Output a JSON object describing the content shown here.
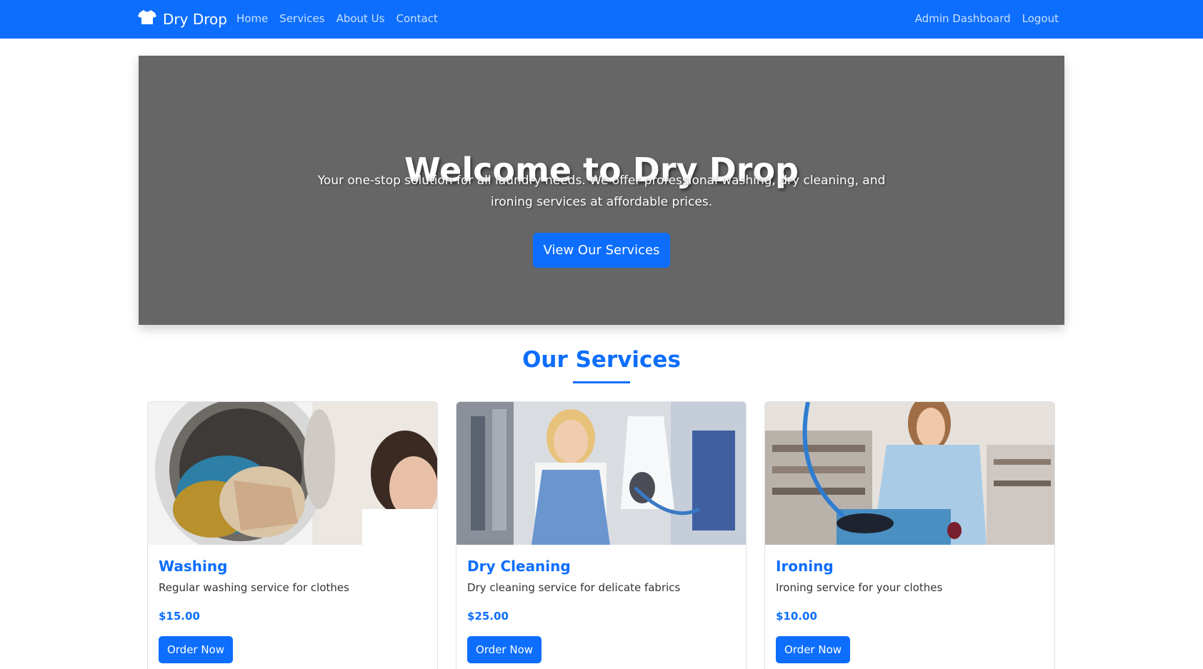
{
  "nav": {
    "brand": "Dry Drop",
    "brand_icon": "tshirt-icon",
    "links": [
      "Home",
      "Services",
      "About Us",
      "Contact"
    ],
    "right_links": [
      "Admin Dashboard",
      "Logout"
    ]
  },
  "hero": {
    "title": "Welcome to Dry Drop",
    "text": "Your one-stop solution for all laundry needs. We offer professional washing, dry cleaning, and ironing services at affordable prices.",
    "button": "View Our Services"
  },
  "services": {
    "heading": "Our Services",
    "cards": [
      {
        "title": "Washing",
        "description": "Regular washing service for clothes",
        "price": "$15.00",
        "button": "Order Now"
      },
      {
        "title": "Dry Cleaning",
        "description": "Dry cleaning service for delicate fabrics",
        "price": "$25.00",
        "button": "Order Now"
      },
      {
        "title": "Ironing",
        "description": "Ironing service for your clothes",
        "price": "$10.00",
        "button": "Order Now"
      }
    ]
  },
  "colors": {
    "primary": "#0d6efd",
    "hero_bg": "#666666"
  }
}
